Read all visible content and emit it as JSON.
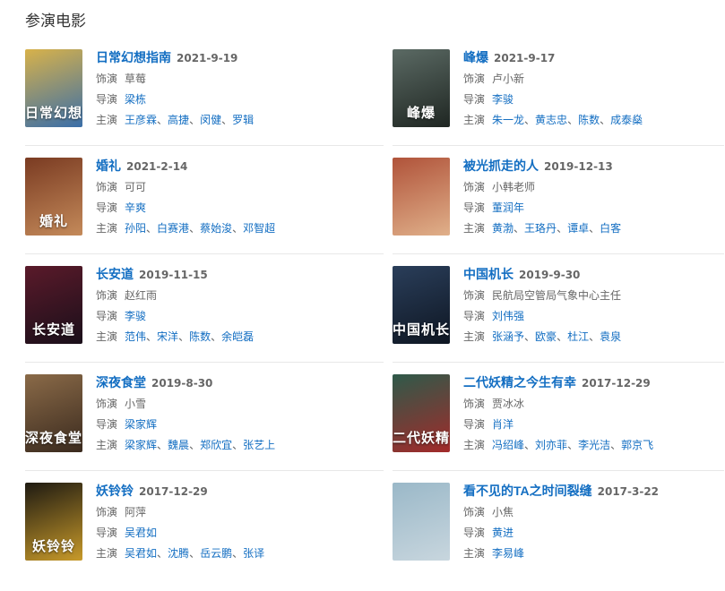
{
  "section": {
    "title": "参演电影"
  },
  "labels": {
    "role": "饰演",
    "director": "导演",
    "cast": "主演"
  },
  "movies": [
    {
      "title": "日常幻想指南",
      "date": "2021-9-19",
      "role": "草莓",
      "director": "梁栋",
      "cast": [
        "王彦霖",
        "高捷",
        "闵健",
        "罗辑"
      ],
      "poster_text": "日常幻想",
      "poster_colors": [
        "#d8b24a",
        "#3a6ea8"
      ]
    },
    {
      "title": "峰爆",
      "date": "2021-9-17",
      "role": "卢小新",
      "director": "李骏",
      "cast": [
        "朱一龙",
        "黄志忠",
        "陈数",
        "成泰燊"
      ],
      "poster_text": "峰爆",
      "poster_colors": [
        "#5b6a64",
        "#1f2622"
      ]
    },
    {
      "title": "婚礼",
      "date": "2021-2-14",
      "role": "可可",
      "director": "辛爽",
      "cast": [
        "孙阳",
        "白赛港",
        "蔡始浚",
        "邓智超"
      ],
      "poster_text": "婚礼",
      "poster_colors": [
        "#7a3b22",
        "#c48a5a"
      ]
    },
    {
      "title": "被光抓走的人",
      "date": "2019-12-13",
      "role": "小韩老师",
      "director": "董润年",
      "cast": [
        "黄渤",
        "王珞丹",
        "谭卓",
        "白客"
      ],
      "poster_text": "",
      "poster_colors": [
        "#b0533a",
        "#e0b08a"
      ]
    },
    {
      "title": "长安道",
      "date": "2019-11-15",
      "role": "赵红雨",
      "director": "李骏",
      "cast": [
        "范伟",
        "宋洋",
        "陈数",
        "余皑磊"
      ],
      "poster_text": "长安道",
      "poster_colors": [
        "#5a1a2a",
        "#1a0f1a"
      ]
    },
    {
      "title": "中国机长",
      "date": "2019-9-30",
      "role": "民航局空管局气象中心主任",
      "director": "刘伟强",
      "cast": [
        "张涵予",
        "欧豪",
        "杜江",
        "袁泉"
      ],
      "poster_text": "中国机长",
      "poster_colors": [
        "#2a3e5a",
        "#0e1622"
      ]
    },
    {
      "title": "深夜食堂",
      "date": "2019-8-30",
      "role": "小雪",
      "director": "梁家辉",
      "cast": [
        "梁家辉",
        "魏晨",
        "郑欣宜",
        "张艺上"
      ],
      "poster_text": "深夜食堂",
      "poster_colors": [
        "#8a6a48",
        "#3a2a1e"
      ]
    },
    {
      "title": "二代妖精之今生有幸",
      "date": "2017-12-29",
      "role": "贾冰冰",
      "director": "肖洋",
      "cast": [
        "冯绍峰",
        "刘亦菲",
        "李光洁",
        "郭京飞"
      ],
      "poster_text": "二代妖精",
      "poster_colors": [
        "#2e5a4a",
        "#a32a2a"
      ]
    },
    {
      "title": "妖铃铃",
      "date": "2017-12-29",
      "role": "阿萍",
      "director": "吴君如",
      "cast": [
        "吴君如",
        "沈腾",
        "岳云鹏",
        "张译"
      ],
      "poster_text": "妖铃铃",
      "poster_colors": [
        "#1e1a12",
        "#c89a2a"
      ]
    },
    {
      "title": "看不见的TA之时间裂缝",
      "date": "2017-3-22",
      "role": "小焦",
      "director": "黄进",
      "cast": [
        "李易峰"
      ],
      "poster_text": "",
      "poster_colors": [
        "#9ab8c8",
        "#c8d6de"
      ]
    }
  ]
}
